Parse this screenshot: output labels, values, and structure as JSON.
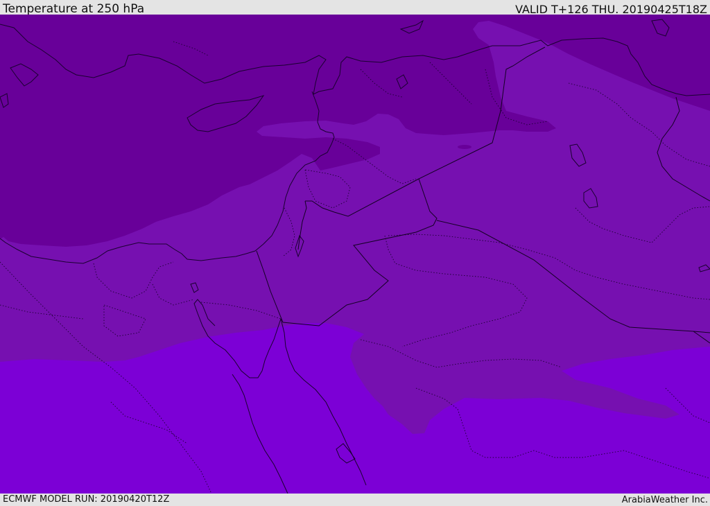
{
  "header": {
    "title": "Temperature at 250 hPa",
    "valid": "VALID T+126 THU. 20190425T18Z"
  },
  "footer": {
    "model_run": "ECMWF MODEL RUN: 20190420T12Z",
    "credit": "ArabiaWeather Inc."
  },
  "map": {
    "field": "temperature",
    "level": "250 hPa",
    "colors": {
      "cold_band": "#680099",
      "mid_band": "#7610b0",
      "warm_band": "#7c00d6",
      "coastline": "#1a0030"
    }
  }
}
